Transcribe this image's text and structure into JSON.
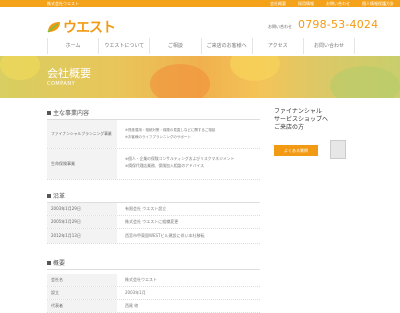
{
  "topbar": {
    "tagline": "株式会社ウエスト",
    "links": [
      "会社概要",
      "採用情報",
      "お問い合わせ",
      "個人情報保護方針"
    ]
  },
  "header": {
    "logo_text": "ウエスト",
    "phone_label": "お問い合わせ",
    "phone": "0798-53-4024"
  },
  "nav": [
    "ホーム",
    "ウエストについて",
    "ご相談",
    "ご来店のお客様へ",
    "アクセス",
    "お問い合わせ"
  ],
  "hero": {
    "title": "会社概要",
    "subtitle": "COMPANY"
  },
  "business": {
    "title": "主な事業内容",
    "rows": [
      {
        "k": "ファイナンシャルプランニング事業",
        "v1": "※資産運用・相続対策・保険の見直しなどに関するご相談",
        "v2": "※お客様のライフプランニングのサポート"
      },
      {
        "k": "生命保険事業",
        "v1": "※個人・企業の保険コンサルティングおよびリスクマネジメント",
        "v2": "※損保代理店業務、保険加入相談のアドバイス"
      }
    ]
  },
  "history": {
    "title": "沿革",
    "rows": [
      {
        "k": "2003年1月29日",
        "v": "有限会社 ウエスト設立"
      },
      {
        "k": "2005年1月29日",
        "v": "株式会社 ウエストに組織変更"
      },
      {
        "k": "2012年1月13日",
        "v": "西宮市甲東園WESTビル建設に伴い本社移転"
      }
    ]
  },
  "overview": {
    "title": "概要",
    "rows": [
      {
        "k": "会社名",
        "v": "株式会社ウエスト"
      },
      {
        "k": "設立",
        "v": "2003年1月"
      },
      {
        "k": "代表者",
        "v": "西尾 修"
      }
    ]
  },
  "sidebar": {
    "banner_line1": "ファイナンシャル",
    "banner_line2": "サービスショップへ",
    "banner_line3": "ご来店の方",
    "button": "よくある質問"
  },
  "colors": {
    "accent": "#f39a14"
  }
}
